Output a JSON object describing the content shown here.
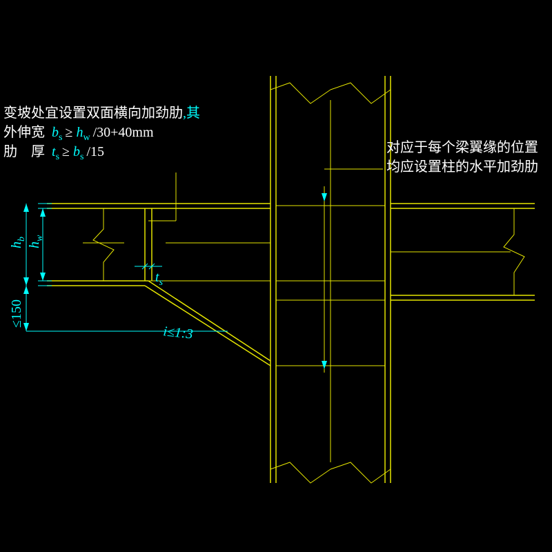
{
  "note_left": {
    "line1_a": "变坡处宜设置双面横向加劲肋",
    "line1_b": ",其",
    "line2_label": "外伸宽",
    "line2_b": "b",
    "line2_bsub": "s",
    "line2_op": " ≥ ",
    "line2_h": "h",
    "line2_hsub": "w",
    "line2_tail": "/30+40mm",
    "line3_label": "肋　厚",
    "line3_t": "t",
    "line3_tsub": "s",
    "line3_op": " ≥ ",
    "line3_b": "b",
    "line3_bsub": "s",
    "line3_tail": "/15"
  },
  "note_right": {
    "line1": "对应于每个梁翼缘的位置",
    "line2": "均应设置柱的水平加劲肋"
  },
  "dims": {
    "hb": "h",
    "hb_sub": "b",
    "hw": "h",
    "hw_sub": "w",
    "d150": "≤150",
    "ts": "t",
    "ts_sub": "s",
    "slope": "i≤1:3"
  }
}
